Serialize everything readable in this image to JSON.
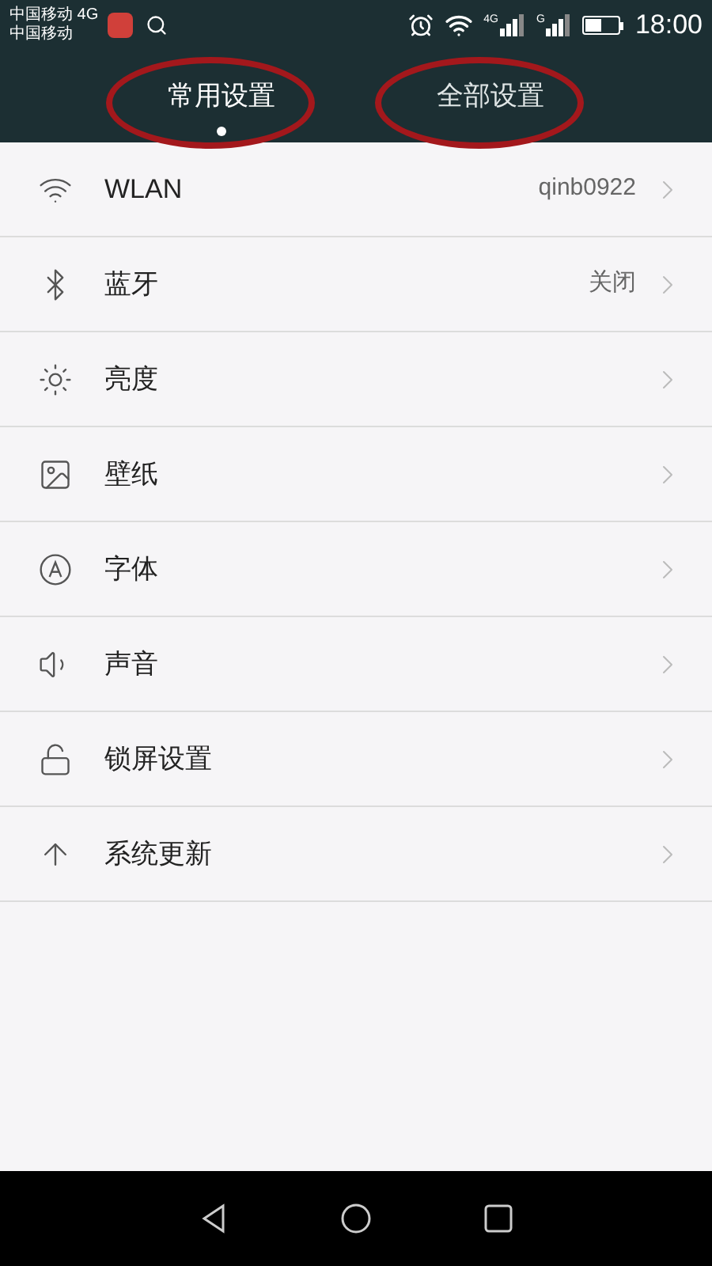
{
  "status_bar": {
    "carriers": [
      "中国移动 4G",
      "中国移动"
    ],
    "signal_labels": [
      "4G",
      "G"
    ],
    "time": "18:00",
    "battery": {
      "level": 0.5
    }
  },
  "tabs": [
    {
      "label": "常用设置",
      "selected": true,
      "circled": true
    },
    {
      "label": "全部设置",
      "selected": false,
      "circled": true
    }
  ],
  "settings": [
    {
      "kind": "wifi",
      "label": "WLAN",
      "value": "qinb0922"
    },
    {
      "kind": "bluetooth",
      "label": "蓝牙",
      "value": "关闭"
    },
    {
      "kind": "brightness",
      "label": "亮度"
    },
    {
      "kind": "wallpaper",
      "label": "壁纸"
    },
    {
      "kind": "font",
      "label": "字体"
    },
    {
      "kind": "sound",
      "label": "声音"
    },
    {
      "kind": "lock",
      "label": "锁屏设置"
    },
    {
      "kind": "update",
      "label": "系统更新"
    }
  ]
}
